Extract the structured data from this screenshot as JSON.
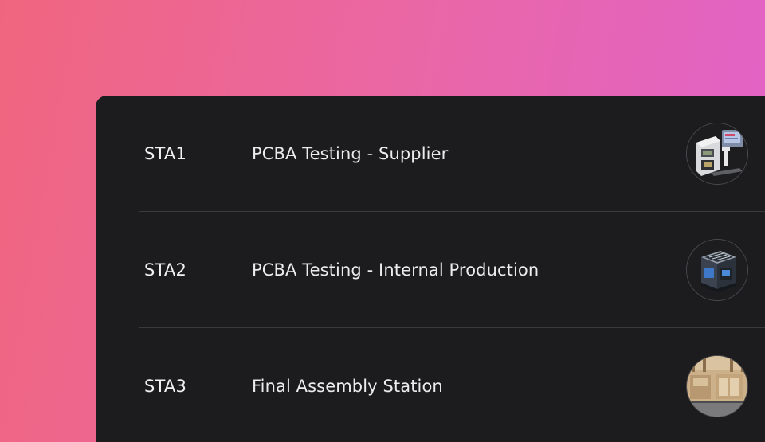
{
  "stations": [
    {
      "code": "STA1",
      "title": "PCBA Testing - Supplier",
      "thumbnail_icon": "supplier-test-rig-icon"
    },
    {
      "code": "STA2",
      "title": "PCBA Testing - Internal Production",
      "thumbnail_icon": "internal-test-enclosure-icon"
    },
    {
      "code": "STA3",
      "title": "Final Assembly Station",
      "thumbnail_icon": "assembly-station-icon"
    }
  ],
  "colors": {
    "background_gradient_start": "#f0657e",
    "background_gradient_end": "#e062c9",
    "panel": "#1c1c1e",
    "divider": "#3a3a3d",
    "text": "#f2f2f2"
  }
}
